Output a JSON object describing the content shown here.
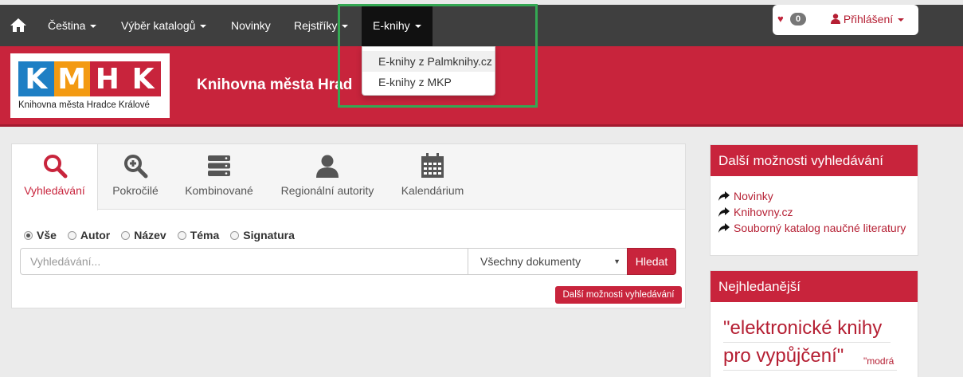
{
  "colors": {
    "brand_red": "#c8243c",
    "navbar": "#3f3f3f",
    "highlight": "#34a853"
  },
  "nav": {
    "home_icon": "home-icon",
    "items": [
      "Čeština",
      "Výběr katalogů",
      "Novinky",
      "Rejstříky",
      "E-knihy"
    ],
    "favorites_count": "0",
    "login_label": "Přihlášení"
  },
  "dropdown": {
    "items": [
      "E-knihy z Palmknihy.cz",
      "E-knihy z MKP"
    ]
  },
  "banner": {
    "logo_letters": [
      "K",
      "M",
      "H",
      "K"
    ],
    "logo_colors": [
      "#1e7fc4",
      "#f39a12",
      "#c8243c",
      "#c8243c"
    ],
    "logo_caption": "Knihovna města Hradce Králové",
    "title": "Knihovna města Hrad"
  },
  "search": {
    "tabs": [
      "Vyhledávání",
      "Pokročilé",
      "Kombinované",
      "Regionální autority",
      "Kalendárium"
    ],
    "active_tab": "Vyhledávání",
    "radios": [
      "Vše",
      "Autor",
      "Název",
      "Téma",
      "Signatura"
    ],
    "selected_radio": "Vše",
    "input_placeholder": "Vyhledávání...",
    "select_value": "Všechny dokumenty",
    "search_button": "Hledat",
    "more_button": "Další možnosti vyhledávání"
  },
  "sidebar": {
    "panel1_title": "Další možnosti vyhledávání",
    "links": [
      "Novinky",
      "Knihovny.cz",
      "Souborný katalog naučné literatury"
    ],
    "panel2_title": "Nejhledanější",
    "tag_line1": "\"elektronické knihy",
    "tag_line2": "pro vypůjčení\"",
    "tag_small": "\"modrá"
  }
}
